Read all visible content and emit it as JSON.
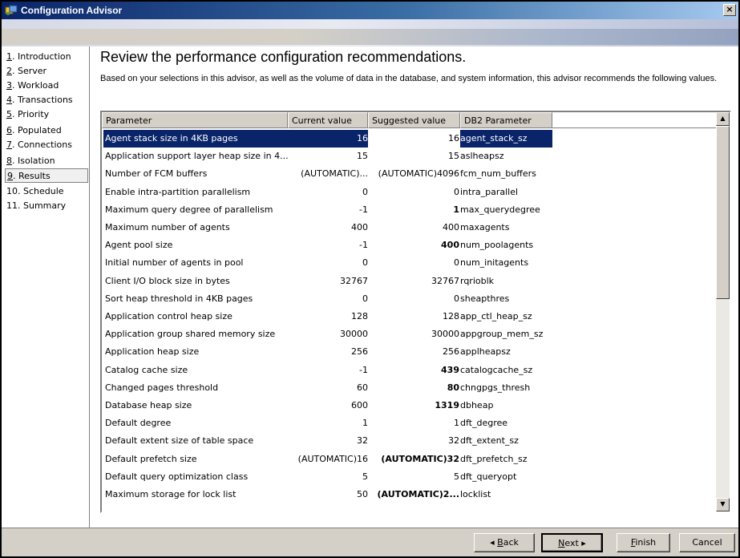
{
  "window": {
    "title": "Configuration Advisor",
    "close_label": "×"
  },
  "nav": {
    "items": [
      {
        "accel": "1",
        "rest": ". Introduction"
      },
      {
        "accel": "2",
        "rest": ". Server"
      },
      {
        "accel": "3",
        "rest": ". Workload"
      },
      {
        "accel": "4",
        "rest": ". Transactions"
      },
      {
        "accel": "5",
        "rest": ". Priority"
      },
      {
        "accel": "6",
        "rest": ". Populated"
      },
      {
        "accel": "7",
        "rest": ". Connections"
      },
      {
        "accel": "8",
        "rest": ". Isolation"
      },
      {
        "accel": "9",
        "rest": ". Results"
      },
      {
        "accel": "",
        "rest": "10. Schedule"
      },
      {
        "accel": "",
        "rest": "11. Summary"
      }
    ],
    "active_index": 8
  },
  "main": {
    "heading": "Review the performance configuration recommendations.",
    "description": "Based on your selections in this advisor, as well as the volume of data in the database, and system information, this advisor recommends the following values."
  },
  "table": {
    "headers": {
      "parameter": "Parameter",
      "current": "Current value",
      "suggested": "Suggested value",
      "db2": "DB2 Parameter"
    },
    "rows": [
      {
        "parameter": "Agent stack size in 4KB pages",
        "current": "16",
        "suggested": "16",
        "db2": "agent_stack_sz",
        "bold": false,
        "selected": true
      },
      {
        "parameter": "Application support layer heap size in 4...",
        "current": "15",
        "suggested": "15",
        "db2": "aslheapsz",
        "bold": false
      },
      {
        "parameter": "Number of FCM buffers",
        "current": "(AUTOMATIC)...",
        "suggested": "(AUTOMATIC)4096",
        "db2": "fcm_num_buffers",
        "bold": false
      },
      {
        "parameter": "Enable intra-partition parallelism",
        "current": "0",
        "suggested": "0",
        "db2": "intra_parallel",
        "bold": false
      },
      {
        "parameter": "Maximum query degree of parallelism",
        "current": "-1",
        "suggested": "1",
        "db2": "max_querydegree",
        "bold": true
      },
      {
        "parameter": "Maximum number of agents",
        "current": "400",
        "suggested": "400",
        "db2": "maxagents",
        "bold": false
      },
      {
        "parameter": "Agent pool size",
        "current": "-1",
        "suggested": "400",
        "db2": "num_poolagents",
        "bold": true
      },
      {
        "parameter": "Initial number of agents in pool",
        "current": "0",
        "suggested": "0",
        "db2": "num_initagents",
        "bold": false
      },
      {
        "parameter": "Client I/O block size in bytes",
        "current": "32767",
        "suggested": "32767",
        "db2": "rqrioblk",
        "bold": false
      },
      {
        "parameter": "Sort heap threshold in 4KB pages",
        "current": "0",
        "suggested": "0",
        "db2": "sheapthres",
        "bold": false
      },
      {
        "parameter": "Application control heap size",
        "current": "128",
        "suggested": "128",
        "db2": "app_ctl_heap_sz",
        "bold": false
      },
      {
        "parameter": "Application group shared memory size",
        "current": "30000",
        "suggested": "30000",
        "db2": "appgroup_mem_sz",
        "bold": false
      },
      {
        "parameter": "Application heap size",
        "current": "256",
        "suggested": "256",
        "db2": "applheapsz",
        "bold": false
      },
      {
        "parameter": "Catalog cache size",
        "current": "-1",
        "suggested": "439",
        "db2": "catalogcache_sz",
        "bold": true
      },
      {
        "parameter": "Changed pages threshold",
        "current": "60",
        "suggested": "80",
        "db2": "chngpgs_thresh",
        "bold": true
      },
      {
        "parameter": "Database heap size",
        "current": "600",
        "suggested": "1319",
        "db2": "dbheap",
        "bold": true
      },
      {
        "parameter": "Default degree",
        "current": "1",
        "suggested": "1",
        "db2": "dft_degree",
        "bold": false
      },
      {
        "parameter": "Default extent size of table space",
        "current": "32",
        "suggested": "32",
        "db2": "dft_extent_sz",
        "bold": false
      },
      {
        "parameter": "Default prefetch size",
        "current": "(AUTOMATIC)16",
        "suggested": "(AUTOMATIC)32",
        "db2": "dft_prefetch_sz",
        "bold": true
      },
      {
        "parameter": "Default query optimization class",
        "current": "5",
        "suggested": "5",
        "db2": "dft_queryopt",
        "bold": false
      },
      {
        "parameter": "Maximum storage for lock list",
        "current": "50",
        "suggested": "(AUTOMATIC)2...",
        "db2": "locklist",
        "bold": true
      }
    ]
  },
  "scrollbar": {
    "up_arrow": "▲",
    "down_arrow": "▼"
  },
  "footer": {
    "back": {
      "arrow": "◂",
      "accel": "B",
      "rest": "ack"
    },
    "next": {
      "accel": "N",
      "rest": "ext",
      "arrow": "▸"
    },
    "finish": {
      "accel": "F",
      "rest": "inish"
    },
    "cancel": "Cancel"
  },
  "colors": {
    "selection": "#0a246a",
    "title_gradient_start": "#0a246a",
    "face": "#d4d0c8"
  }
}
